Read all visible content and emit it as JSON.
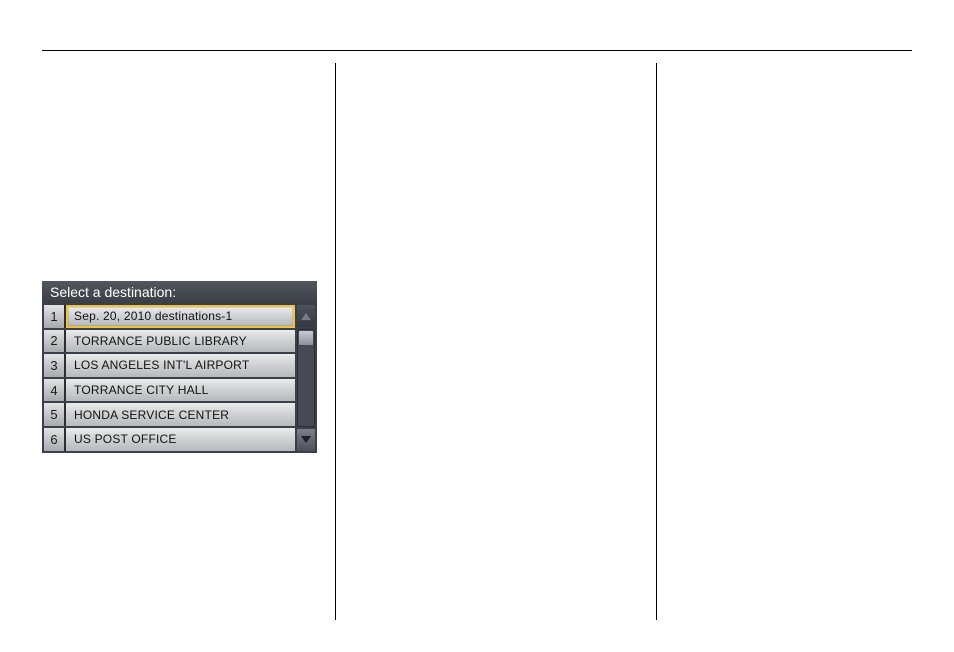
{
  "panel": {
    "header": "Select a destination:",
    "items": [
      {
        "num": "1",
        "label": "Sep. 20, 2010 destinations-1",
        "selected": true
      },
      {
        "num": "2",
        "label": "TORRANCE PUBLIC LIBRARY",
        "selected": false
      },
      {
        "num": "3",
        "label": "LOS ANGELES INT'L AIRPORT",
        "selected": false
      },
      {
        "num": "4",
        "label": "TORRANCE CITY HALL",
        "selected": false
      },
      {
        "num": "5",
        "label": "HONDA SERVICE CENTER",
        "selected": false
      },
      {
        "num": "6",
        "label": "US POST OFFICE",
        "selected": false
      }
    ]
  }
}
